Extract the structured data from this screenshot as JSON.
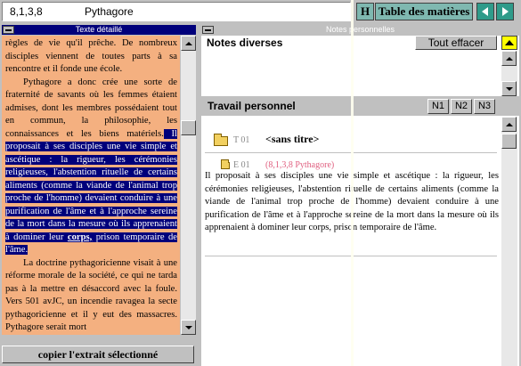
{
  "topbar": {
    "reference": "8,1,3,8",
    "name": "Pythagore",
    "h_label": "H",
    "toc_label": "Table des matières"
  },
  "left": {
    "header": "Texte détaillé",
    "paragraphs": [
      {
        "before": "règles de vie qu'il prêche. De nombreux disciples viennent de toutes parts à sa rencontre et il fonde une école.",
        "indent": false
      },
      {
        "before": "Pythagore a donc crée une sorte de fraternité de savants où les femmes étaient admises, dont les membres possédaient tout en commun, la philosophie, les connaissances et les biens matériels.",
        "selected": " Il proposait à ses disciples une vie simple et ascétique : la rigueur, les cérémonies religieuses, l'abstention rituelle de certains aliments (comme la viande de l'animal trop proche de l'homme) devaient conduire à une purification de l'âme et à l'approche sereine de la mort dans la mesure où ils apprenaient à dominer leur ",
        "selected_bold": "corps,",
        "selected_after": " prison temporaire de l'âme.",
        "indent": true
      },
      {
        "before": "La doctrine pythagoricienne visait à une réforme morale de la société, ce qui ne tarda pas à la mettre en désaccord avec la foule. Vers 501 avJC, un incendie ravagea la secte pythagoricienne et il y eut des massacres. Pythagore serait mort",
        "indent": true
      }
    ],
    "copy_button": "copier l'extrait sélectionné"
  },
  "right": {
    "header": "Notes personnelles",
    "notes_title": "Notes diverses",
    "clear_button": "Tout effacer",
    "work_title": "Travail personnel",
    "n_buttons": [
      "N1",
      "N2",
      "N3"
    ],
    "topic": {
      "label": "T 01",
      "title": "<sans titre>"
    },
    "extract": {
      "label": "E 01",
      "ref": "(8,1,3,8 Pythagore)",
      "text": "Il proposait à ses disciples une vie simple et ascétique : la rigueur, les cérémonies religieuses, l'abstention rituelle de certains aliments (comme la viande de l'animal trop proche de l'homme) devaient conduire à une purification de l'âme et à l'approche sereine de la mort dans la mesure où ils apprenaient à dominer leur corps, prison temporaire de l'âme."
    }
  },
  "colors": {
    "title_blue": "#00007b",
    "text_bg": "#f4b080",
    "nav_teal": "#2f9b8a",
    "toc_teal": "#7fb8b0",
    "extract_ref": "#e06080"
  }
}
